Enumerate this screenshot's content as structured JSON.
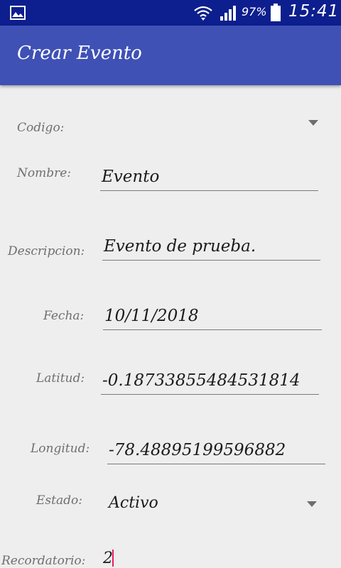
{
  "status_bar": {
    "battery_percent": "97%",
    "time": "15:41",
    "icons": [
      "gallery-icon",
      "wifi-icon",
      "signal-icon",
      "battery-icon"
    ]
  },
  "app_bar": {
    "title": "Crear Evento",
    "color": "#3f51b5"
  },
  "form": {
    "codigo": {
      "label": "Codigo:",
      "value": ""
    },
    "nombre": {
      "label": "Nombre:",
      "value": "Evento"
    },
    "descripcion": {
      "label": "Descripcion:",
      "value": "Evento de prueba."
    },
    "fecha": {
      "label": "Fecha:",
      "value": "10/11/2018"
    },
    "latitud": {
      "label": "Latitud:",
      "value": "-0.18733855484531814"
    },
    "longitud": {
      "label": "Longitud:",
      "value": "-78.48895199596882"
    },
    "estado": {
      "label": "Estado:",
      "value": "Activo"
    },
    "recordatorio": {
      "label": "Recordatorio:",
      "value": "2"
    }
  },
  "accent_color": "#e91e63"
}
